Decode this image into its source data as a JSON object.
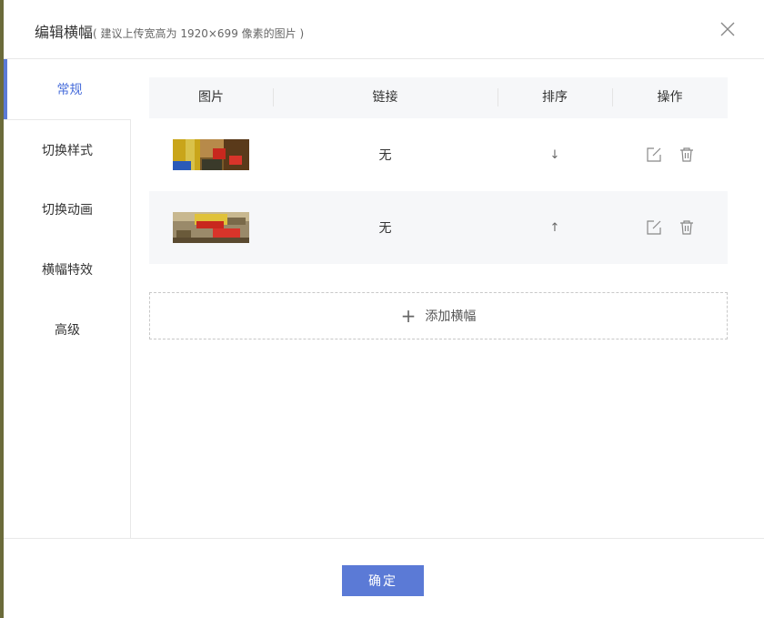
{
  "dialog": {
    "title": "编辑横幅",
    "hint": "( 建议上传宽高为 1920×699 像素的图片 )"
  },
  "sidebar": {
    "items": [
      {
        "label": "常规",
        "active": true
      },
      {
        "label": "切换样式",
        "active": false
      },
      {
        "label": "切换动画",
        "active": false
      },
      {
        "label": "横幅特效",
        "active": false
      },
      {
        "label": "高级",
        "active": false
      }
    ]
  },
  "table": {
    "columns": [
      "图片",
      "链接",
      "排序",
      "操作"
    ],
    "rows": [
      {
        "link": "无",
        "sort_arrow": "↓"
      },
      {
        "link": "无",
        "sort_arrow": "↑"
      }
    ]
  },
  "add_button": {
    "label": "添加横幅"
  },
  "footer": {
    "confirm_label": "确定"
  },
  "colors": {
    "accent": "#5b7ad6",
    "header_bg": "#f6f7f9"
  }
}
